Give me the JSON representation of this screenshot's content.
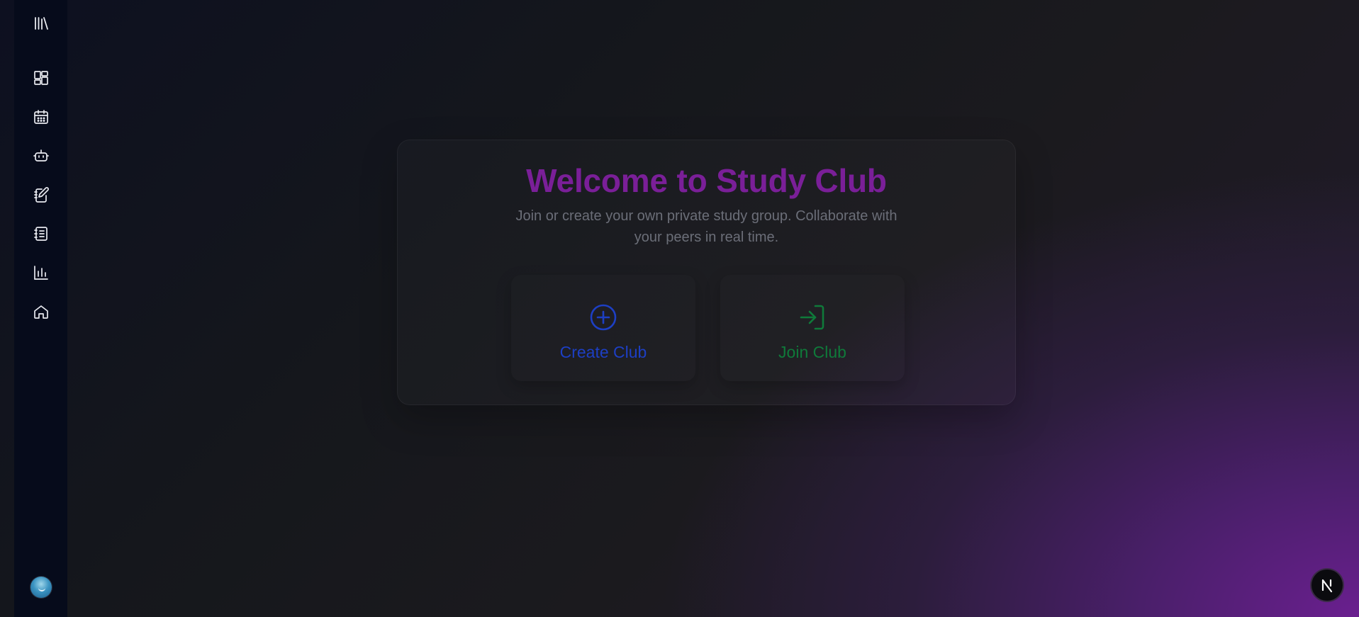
{
  "sidebar": {
    "logo_icon": "library-icon",
    "items": [
      {
        "icon": "dashboard-icon"
      },
      {
        "icon": "calendar-icon"
      },
      {
        "icon": "robot-icon"
      },
      {
        "icon": "notebook-edit-icon"
      },
      {
        "icon": "notebook-list-icon"
      },
      {
        "icon": "bar-chart-icon"
      },
      {
        "icon": "home-icon"
      }
    ],
    "avatar_icon": "user-avatar"
  },
  "main": {
    "title": "Welcome to Study Club",
    "subtitle": "Join or create your own private study group. Collaborate with your peers in real time.",
    "actions": [
      {
        "label": "Create Club",
        "icon": "plus-circle-icon",
        "color": "#1d3fc4"
      },
      {
        "label": "Join Club",
        "icon": "sign-in-icon",
        "color": "#0f7a3a"
      }
    ]
  },
  "badge": {
    "label": "N"
  },
  "colors": {
    "title": "#7a1f98",
    "sidebar_bg": "#060b1b",
    "accent_gradient": "#6a1f8f"
  }
}
